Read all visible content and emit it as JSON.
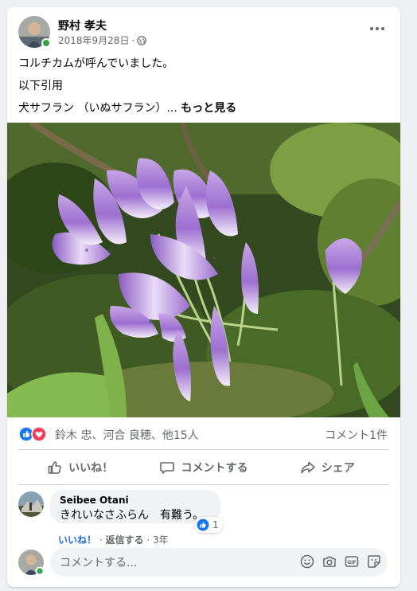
{
  "post": {
    "author": "野村 孝夫",
    "date": "2018年9月28日",
    "separator": "·",
    "privacy_icon": "globe-icon",
    "text_lines": [
      "コルチカムが呼んでいました。",
      "以下引用"
    ],
    "text_truncated": "犬サフラン （いぬサフラン）...",
    "see_more": "もっと見る"
  },
  "reactions": {
    "icons": [
      "like-icon",
      "love-icon"
    ],
    "names": "鈴木 忠、河合 良穂、他15人",
    "comment_count": "コメント1件"
  },
  "actions": {
    "like": "いいね！",
    "comment": "コメントする",
    "share": "シェア"
  },
  "comment": {
    "author": "Seibee Otani",
    "text": "きれいなさふらん　有難う。",
    "like_link": "いいね！",
    "dot": "·",
    "reply_link": "返信する",
    "age": "3年",
    "reaction_count": "1"
  },
  "composer": {
    "placeholder": "コメントする..."
  },
  "colors": {
    "accent": "#216fdb",
    "like_blue": "#1877f2",
    "love_red": "#f33e58",
    "online_green": "#31a24c"
  }
}
